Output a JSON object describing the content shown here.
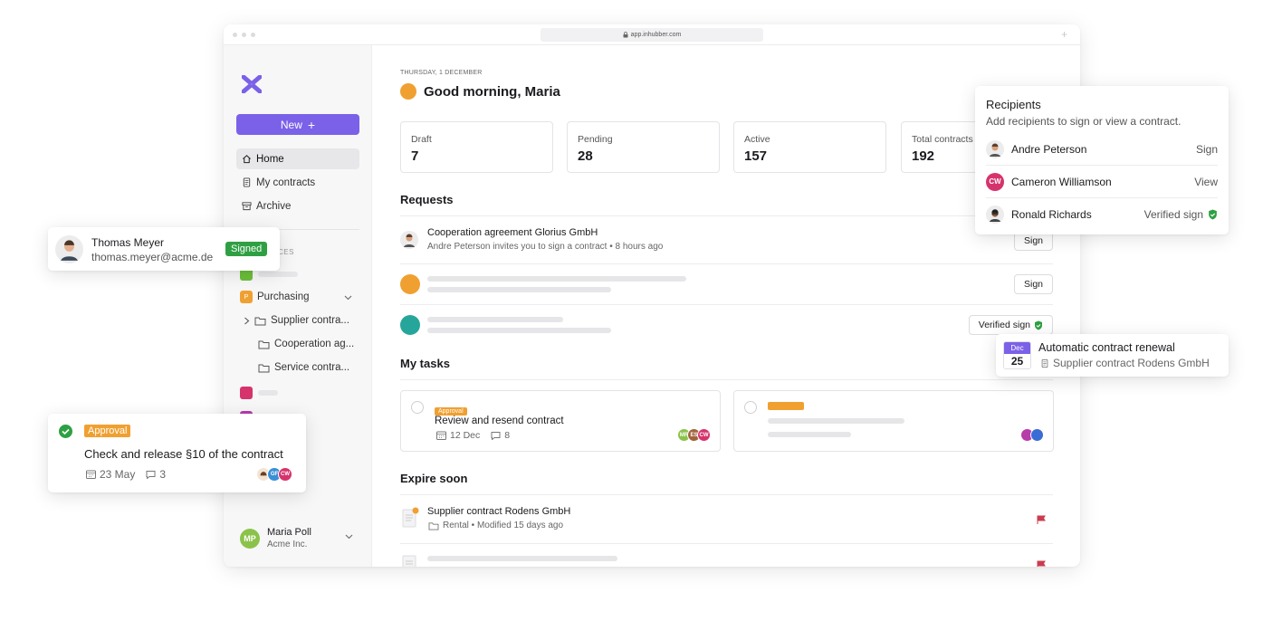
{
  "browser": {
    "url": "app.inhubber.com"
  },
  "sidebar": {
    "new_label": "New",
    "nav": [
      {
        "label": "Home"
      },
      {
        "label": "My contracts"
      },
      {
        "label": "Archive"
      }
    ],
    "spaces_label": "CES",
    "purchasing": {
      "badge": "P",
      "label": "Purchasing"
    },
    "folders": [
      {
        "label": "Supplier contra..."
      },
      {
        "label": "Cooperation ag..."
      },
      {
        "label": "Service contra..."
      }
    ],
    "user": {
      "initials": "MP",
      "name": "Maria Poll",
      "org": "Acme Inc."
    }
  },
  "main": {
    "date": "THURSDAY, 1 DECEMBER",
    "greeting": "Good morning, Maria",
    "stats": [
      {
        "label": "Draft",
        "value": "7"
      },
      {
        "label": "Pending",
        "value": "28"
      },
      {
        "label": "Active",
        "value": "157"
      },
      {
        "label": "Total contracts",
        "value": "192"
      }
    ],
    "requests_title": "Requests",
    "request": {
      "title": "Cooperation agreement Glorius GmbH",
      "subtitle": "Andre Peterson invites you to sign a contract • 8 hours ago",
      "action": "Sign"
    },
    "request2_action": "Sign",
    "request3_action": "Verified sign",
    "tasks_title": "My tasks",
    "task": {
      "tag": "Approval",
      "title": "Review and resend contract",
      "date": "12 Dec",
      "comments": "8",
      "avatars": [
        "MR",
        "ES",
        "CW"
      ]
    },
    "expire_title": "Expire soon",
    "expire": {
      "title": "Supplier contract Rodens GmbH",
      "meta": "Rental • Modified 15 days ago"
    }
  },
  "recipients": {
    "title": "Recipients",
    "subtitle": "Add recipients to sign or view a contract.",
    "rows": [
      {
        "name": "Andre Peterson",
        "action": "Sign"
      },
      {
        "name": "Cameron Williamson",
        "initials": "CW",
        "action": "View"
      },
      {
        "name": "Ronald Richards",
        "action": "Verified sign"
      }
    ]
  },
  "thomas": {
    "name": "Thomas Meyer",
    "email": "thomas.meyer@acme.de",
    "badge": "Signed"
  },
  "approval": {
    "tag": "Approval",
    "title": "Check and release §10 of the contract",
    "date": "23 May",
    "comments": "3",
    "avatars": [
      "GF",
      "CW"
    ]
  },
  "renewal": {
    "month": "Dec",
    "day": "25",
    "title": "Automatic contract renewal",
    "subtitle": "Supplier contract Rodens GmbH"
  },
  "colors": {
    "accent": "#7b61e8",
    "orange": "#f0a030",
    "green": "#2ea043",
    "teal": "#26a69a",
    "red": "#c93c4e"
  }
}
